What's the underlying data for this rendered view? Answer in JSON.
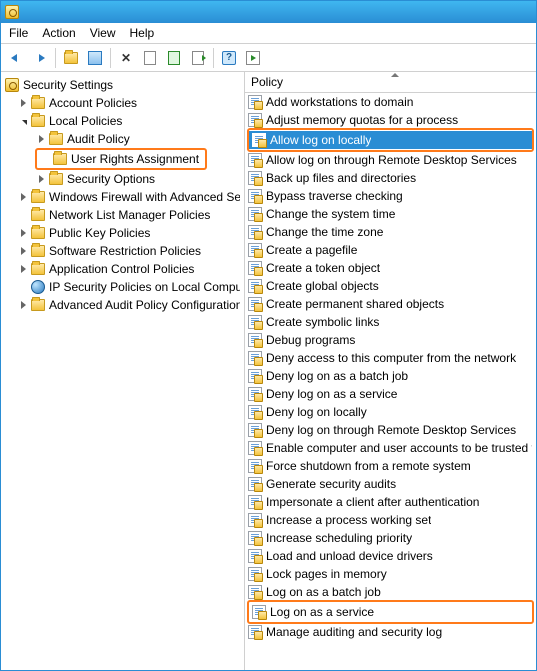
{
  "menubar": {
    "file": "File",
    "action": "Action",
    "view": "View",
    "help": "Help"
  },
  "list_header": "Policy",
  "tree": {
    "root": "Security Settings",
    "account_policies": "Account Policies",
    "local_policies": "Local Policies",
    "audit_policy": "Audit Policy",
    "user_rights": "User Rights Assignment",
    "security_options": "Security Options",
    "windows_firewall": "Windows Firewall with Advanced Security",
    "network_list": "Network List Manager Policies",
    "public_key": "Public Key Policies",
    "software_restriction": "Software Restriction Policies",
    "app_control": "Application Control Policies",
    "ipsec": "IP Security Policies on Local Computer",
    "adv_audit": "Advanced Audit Policy Configuration"
  },
  "policies": [
    "Add workstations to domain",
    "Adjust memory quotas for a process",
    "Allow log on locally",
    "Allow log on through Remote Desktop Services",
    "Back up files and directories",
    "Bypass traverse checking",
    "Change the system time",
    "Change the time zone",
    "Create a pagefile",
    "Create a token object",
    "Create global objects",
    "Create permanent shared objects",
    "Create symbolic links",
    "Debug programs",
    "Deny access to this computer from the network",
    "Deny log on as a batch job",
    "Deny log on as a service",
    "Deny log on locally",
    "Deny log on through Remote Desktop Services",
    "Enable computer and user accounts to be trusted for delegation",
    "Force shutdown from a remote system",
    "Generate security audits",
    "Impersonate a client after authentication",
    "Increase a process working set",
    "Increase scheduling priority",
    "Load and unload device drivers",
    "Lock pages in memory",
    "Log on as a batch job",
    "Log on as a service",
    "Manage auditing and security log"
  ],
  "selected_index": 2,
  "highlighted_indices": [
    2,
    28
  ]
}
